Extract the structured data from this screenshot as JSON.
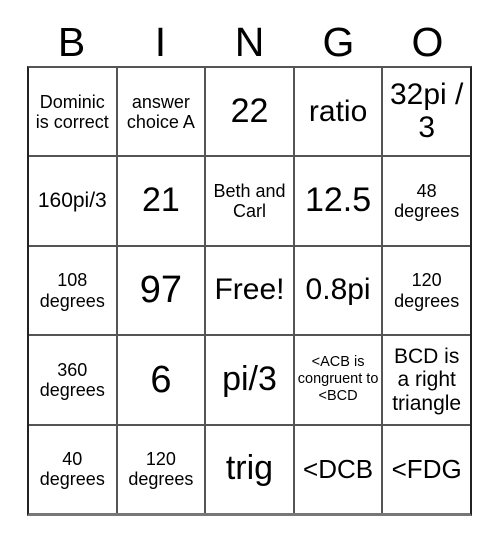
{
  "card": {
    "title": "BINGO",
    "header_letters": [
      "B",
      "I",
      "N",
      "G",
      "O"
    ],
    "rows": [
      [
        {
          "text": "Dominic is correct",
          "size": "fs-sm"
        },
        {
          "text": "answer choice A",
          "size": "fs-sm"
        },
        {
          "text": "22",
          "size": "fs-xxl"
        },
        {
          "text": "ratio",
          "size": "fs-xl"
        },
        {
          "text": "32pi / 3",
          "size": "fs-xl"
        }
      ],
      [
        {
          "text": "160pi/3",
          "size": "fs-md"
        },
        {
          "text": "21",
          "size": "fs-xxl"
        },
        {
          "text": "Beth and Carl",
          "size": "fs-sm"
        },
        {
          "text": "12.5",
          "size": "fs-xxl"
        },
        {
          "text": "48 degrees",
          "size": "fs-sm"
        }
      ],
      [
        {
          "text": "108 degrees",
          "size": "fs-sm"
        },
        {
          "text": "97",
          "size": "fs-huge"
        },
        {
          "text": "Free!",
          "size": "fs-xl"
        },
        {
          "text": "0.8pi",
          "size": "fs-xl"
        },
        {
          "text": "120 degrees",
          "size": "fs-sm"
        }
      ],
      [
        {
          "text": "360 degrees",
          "size": "fs-sm"
        },
        {
          "text": "6",
          "size": "fs-huge"
        },
        {
          "text": "pi/3",
          "size": "fs-xxl"
        },
        {
          "text": "<ACB is congruent to <BCD",
          "size": "fs-xs"
        },
        {
          "text": "BCD is a right triangle",
          "size": "fs-md"
        }
      ],
      [
        {
          "text": "40 degrees",
          "size": "fs-sm"
        },
        {
          "text": "120 degrees",
          "size": "fs-sm"
        },
        {
          "text": "trig",
          "size": "fs-xxl"
        },
        {
          "text": "<DCB",
          "size": "fs-lg"
        },
        {
          "text": "<FDG",
          "size": "fs-lg"
        }
      ]
    ],
    "free_space": {
      "row": 2,
      "column": 2,
      "label": "Free!"
    },
    "colors": {
      "background": "#ffffff",
      "text": "#000000",
      "grid_line": "#555555",
      "grid_border": "#222222"
    }
  }
}
